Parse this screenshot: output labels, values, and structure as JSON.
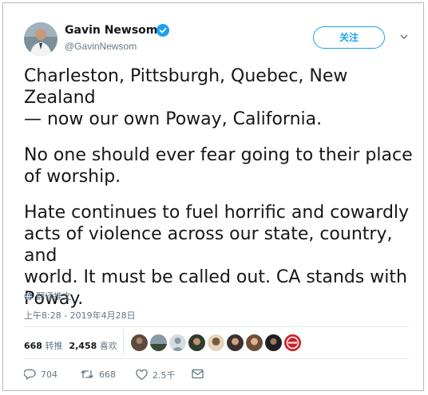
{
  "user": {
    "display_name": "Gavin Newsom",
    "handle": "@GavinNewsom"
  },
  "follow_label": "关注",
  "tweet": {
    "paragraphs": [
      "Charleston, Pittsburgh, Quebec, New Zealand\n— now our own Poway, California.",
      "No one should ever fear going to their place\nof worship.",
      "Hate continues to fuel horrific and cowardly\nacts of violence across our state, country, and\nworld. It must be called out. CA stands with\nPoway."
    ]
  },
  "translate_label": "翻译推文",
  "timestamp": "上午8:28 - 2019年4月28日",
  "stats": {
    "retweets_count": "668",
    "retweets_label": "转推",
    "likes_count": "2,458",
    "likes_label": "喜欢"
  },
  "actions": {
    "reply_count": "704",
    "retweet_count": "668",
    "like_count": "2.5千"
  },
  "colors": {
    "accent": "#1da1f2",
    "secondary_text": "#657786",
    "border": "#e1e8ed"
  },
  "icons": [
    "verified-badge-icon",
    "chevron-down-icon",
    "globe-icon",
    "reply-icon",
    "retweet-icon",
    "heart-icon",
    "message-icon"
  ]
}
